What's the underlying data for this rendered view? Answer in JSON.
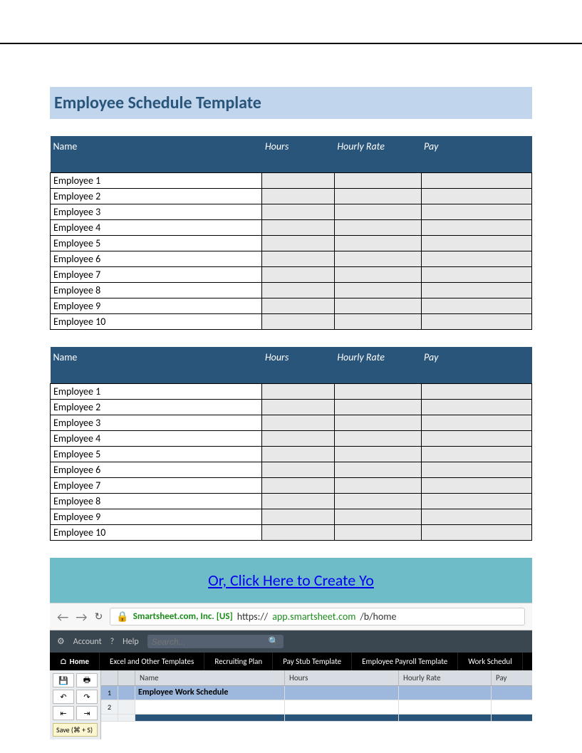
{
  "title": "Employee Schedule Template",
  "columns": [
    "Name",
    "Hours",
    "Hourly Rate",
    "Pay"
  ],
  "tables": [
    {
      "rows": [
        "Employee 1",
        "Employee 2",
        "Employee 3",
        "Employee 4",
        "Employee 5",
        "Employee 6",
        "Employee 7",
        "Employee 8",
        "Employee 9",
        "Employee 10"
      ]
    },
    {
      "rows": [
        "Employee 1",
        "Employee 2",
        "Employee 3",
        "Employee 4",
        "Employee 5",
        "Employee 6",
        "Employee 7",
        "Employee 8",
        "Employee 9",
        "Employee 10"
      ]
    }
  ],
  "banner_link": "Or, Click Here to Create Yo",
  "browser": {
    "cert_label": "Smartsheet.com, Inc. [US]",
    "url_prefix": "https://",
    "url_host": "app.smartsheet.com",
    "url_path": "/b/home"
  },
  "app": {
    "account_label": "Account",
    "help_label": "Help",
    "search_placeholder": "Search...",
    "tabs": [
      "Home",
      "Excel and Other Templates",
      "Recruiting Plan",
      "Pay Stub Template",
      "Employee Payroll Template",
      "Work Schedul"
    ],
    "tooltip": "Save (⌘ + S)",
    "col_headers": [
      "",
      "",
      "Name",
      "Hours",
      "Hourly Rate",
      "Pay"
    ],
    "sheet_title": "Employee Work Schedule"
  }
}
